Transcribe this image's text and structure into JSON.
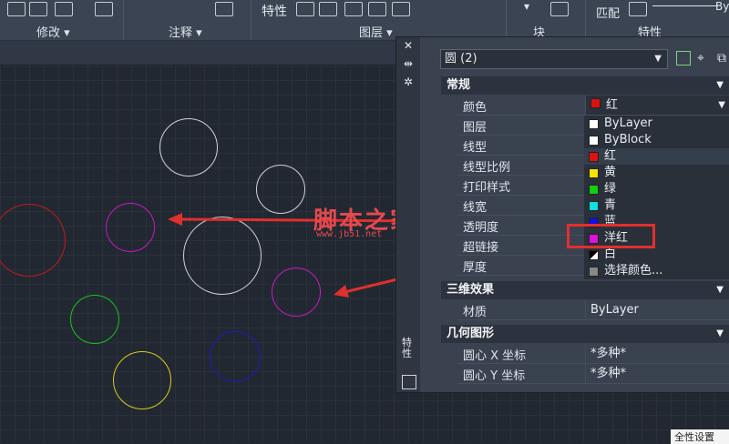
{
  "ribbon": {
    "modify_label": "修改",
    "annotation_label": "注释",
    "layers_label": "图层",
    "block_label": "块",
    "properties_label": "特性",
    "properties_btn": "特性",
    "match_label": "匹配",
    "bylayer_short": "By",
    "dropdown_arrow": "▾"
  },
  "palette": {
    "selection": "圆 (2)",
    "sections": {
      "general": "常规",
      "effects3d": "三维效果",
      "geometry": "几何图形"
    },
    "general_rows": [
      {
        "label": "颜色",
        "value": "红"
      },
      {
        "label": "图层",
        "value": ""
      },
      {
        "label": "线型",
        "value": ""
      },
      {
        "label": "线型比例",
        "value": ""
      },
      {
        "label": "打印样式",
        "value": ""
      },
      {
        "label": "线宽",
        "value": ""
      },
      {
        "label": "透明度",
        "value": ""
      },
      {
        "label": "超链接",
        "value": ""
      },
      {
        "label": "厚度",
        "value": ""
      }
    ],
    "effects_rows": [
      {
        "label": "材质",
        "value": "ByLayer"
      }
    ],
    "geometry_rows": [
      {
        "label": "圆心 X 坐标",
        "value": "*多种*"
      },
      {
        "label": "圆心 Y 坐标",
        "value": "*多种*"
      }
    ],
    "side_label": "特性",
    "color_options": [
      {
        "label": "ByLayer",
        "swatch": "#ffffff"
      },
      {
        "label": "ByBlock",
        "swatch": "#ffffff"
      },
      {
        "label": "红",
        "swatch": "#e01010"
      },
      {
        "label": "黄",
        "swatch": "#f4e600"
      },
      {
        "label": "绿",
        "swatch": "#10d010"
      },
      {
        "label": "青",
        "swatch": "#10e0e0"
      },
      {
        "label": "蓝",
        "swatch": "#1010e0"
      },
      {
        "label": "洋红",
        "swatch": "#e010e0"
      },
      {
        "label": "白",
        "swatch": "#ffffff"
      },
      {
        "label": "选择颜色...",
        "swatch": "#888888"
      }
    ]
  },
  "watermark": {
    "text": "脚本之家",
    "url": "www.jb51.net"
  },
  "tooltip": "全性设置",
  "colors": {
    "accent_red": "#e0302e"
  }
}
